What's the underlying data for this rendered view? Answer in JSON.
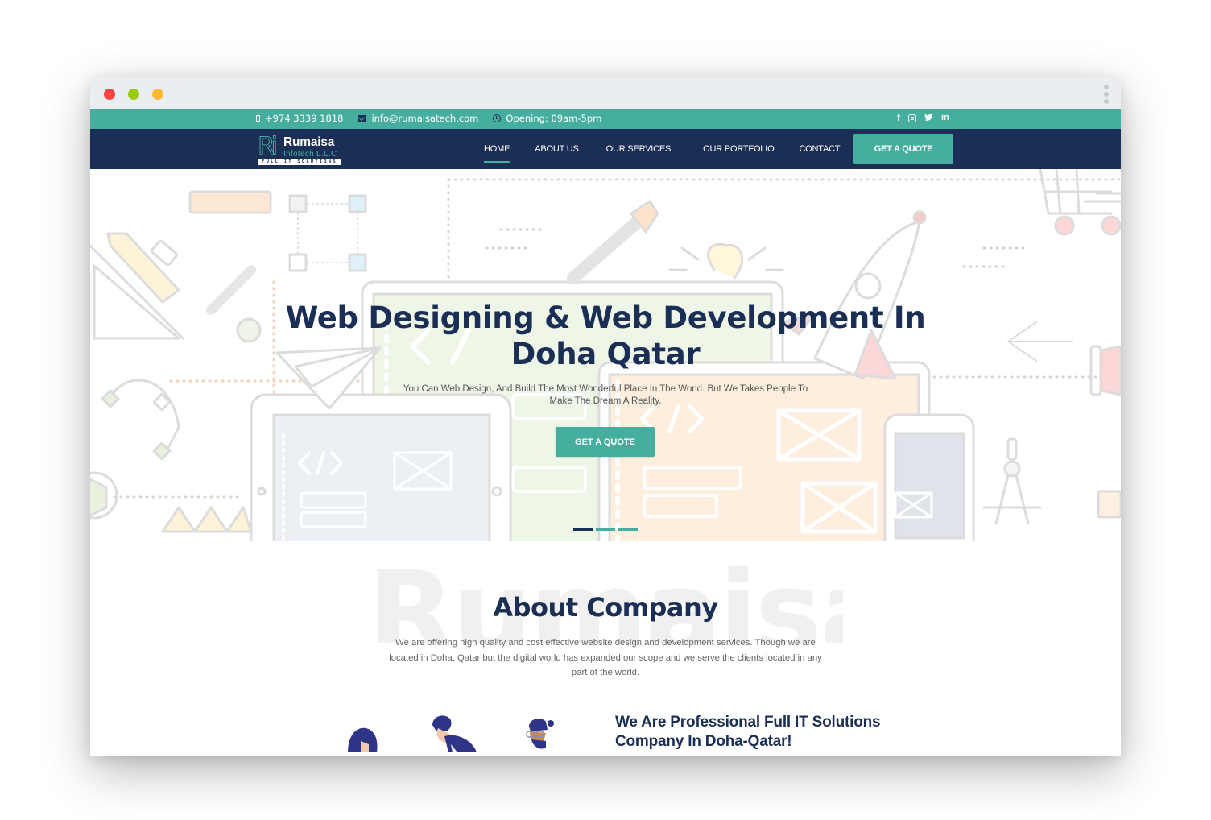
{
  "browser": {
    "controls": [
      "close",
      "minimize",
      "maximize"
    ],
    "menu_icon": "kebab-menu-icon"
  },
  "topbar": {
    "phone": "+974 3339 1818",
    "email": "info@rumaisatech.com",
    "hours": "Opening: 09am-5pm",
    "social": [
      {
        "name": "facebook",
        "glyph": "f"
      },
      {
        "name": "instagram",
        "glyph": ""
      },
      {
        "name": "twitter",
        "glyph": "🐦"
      },
      {
        "name": "linkedin",
        "glyph": "in"
      }
    ]
  },
  "logo": {
    "mark": "Ri",
    "name": "Rumaisa",
    "subtitle": "Infotech L.L.C",
    "tagline": "FULL IT SOLUTIONS"
  },
  "nav": {
    "items": [
      "HOME",
      "ABOUT US",
      "OUR SERVICES",
      "OUR PORTFOLIO",
      "CONTACT"
    ],
    "active": "HOME",
    "cta": "GET A QUOTE"
  },
  "hero": {
    "title_line1": "Web Designing & Web Development In",
    "title_line2": "Doha Qatar",
    "subtitle_line1": "You Can Web Design, And Build The Most Wonderful Place In The World. But We Takes People To",
    "subtitle_line2": "Make The Dream A Reality.",
    "cta": "GET A QUOTE",
    "slides": 3,
    "active_slide": 1
  },
  "about": {
    "watermark": "Rumaisa",
    "title": "About Company",
    "text": "We are offering high quality and cost effective website design and development services. Though we are located in Doha, Qatar but the digital world has expanded our scope and we serve the clients located in any part of the world.",
    "subheading_line1": "We Are Professional Full IT Solutions",
    "subheading_line2": "Company In Doha-Qatar!"
  },
  "colors": {
    "teal": "#46ae9f",
    "navy": "#1b2f56",
    "titlebar": "#ebeef0"
  }
}
